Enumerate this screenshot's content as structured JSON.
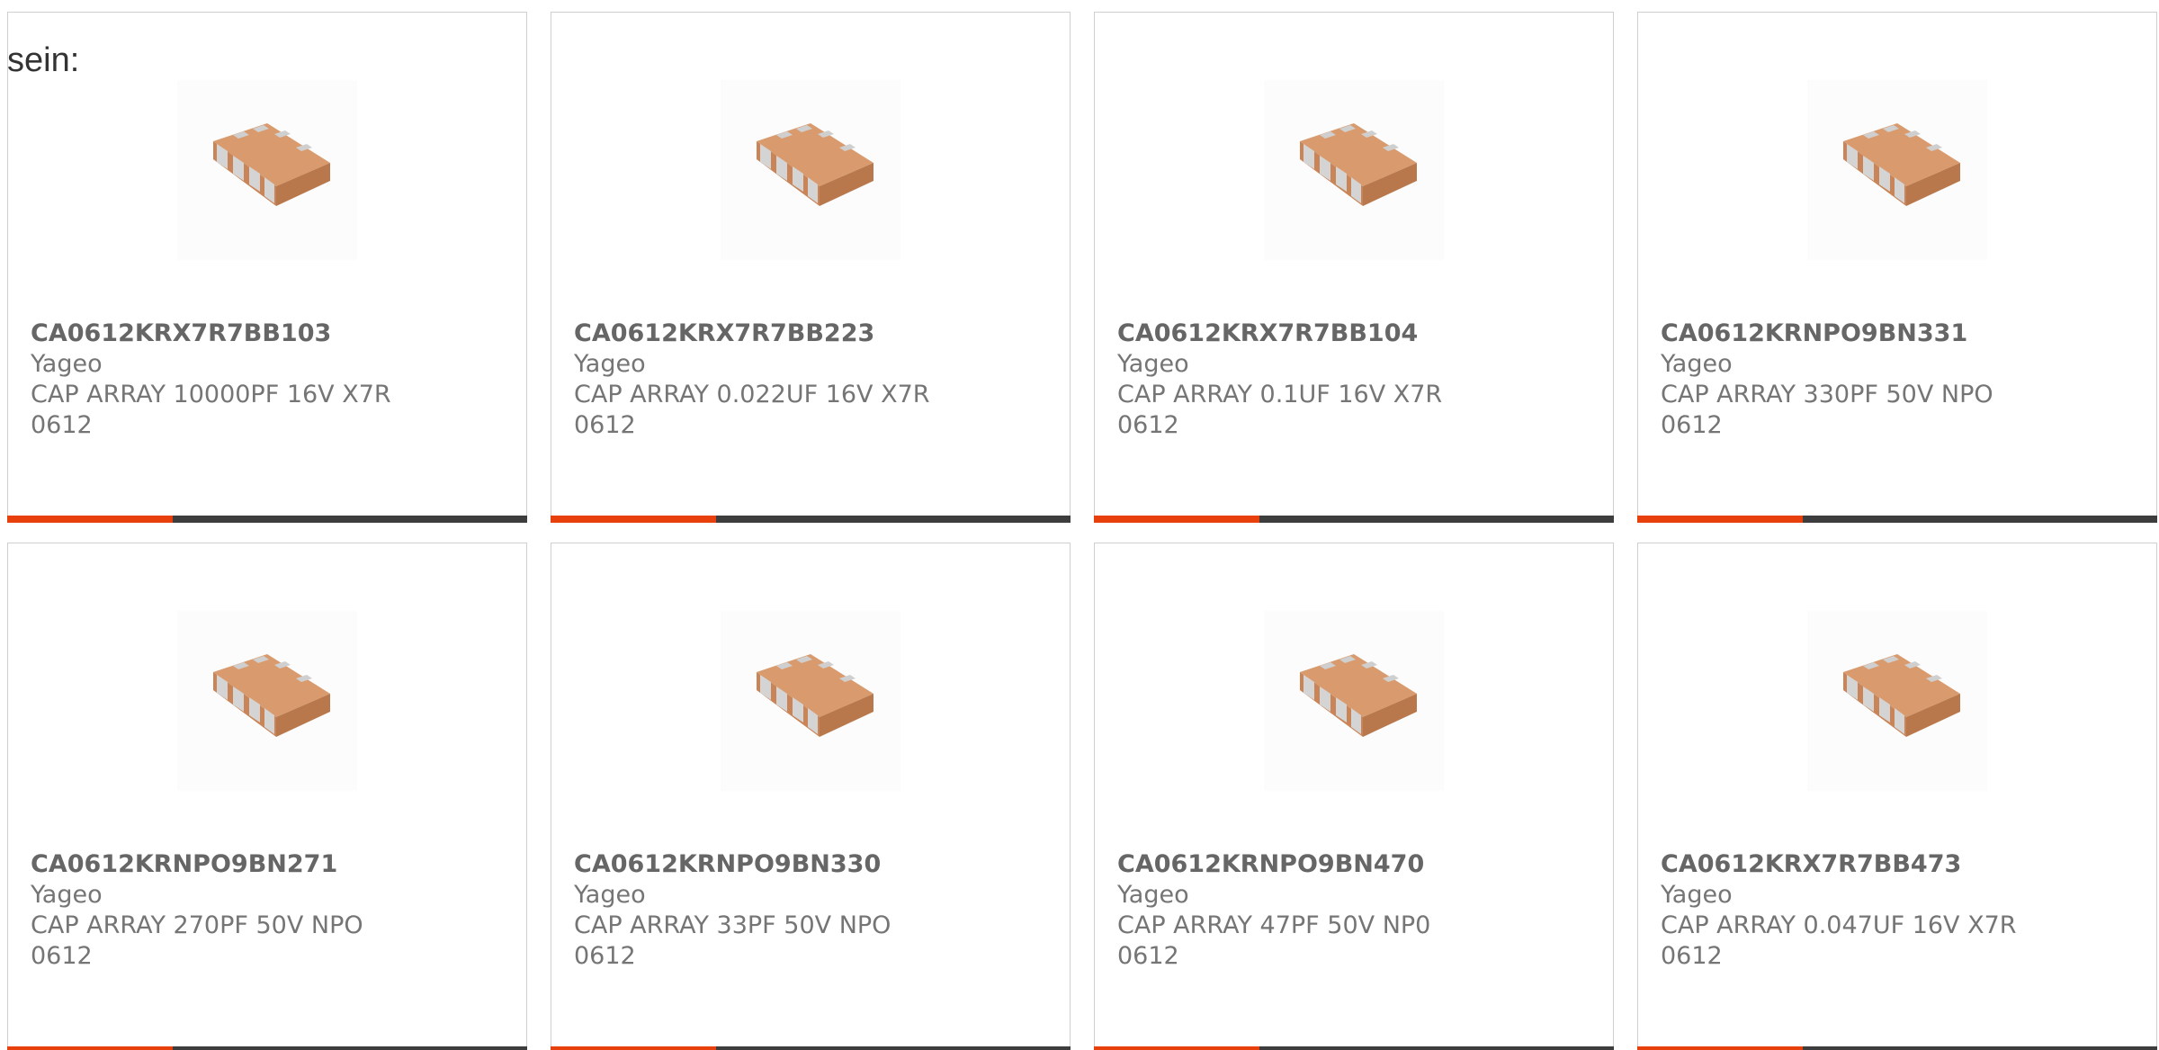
{
  "lead_text": "sein:",
  "colors": {
    "accent": "#e8400d",
    "bar_track": "#3d3d3d",
    "chip_body": "#d99b6e",
    "chip_terminal": "#c8c8c8"
  },
  "products": [
    {
      "part_number": "CA0612KRX7R7BB103",
      "manufacturer": "Yageo",
      "description": "CAP ARRAY 10000PF 16V X7R 0612",
      "image_icon": "capacitor-array-chip-icon"
    },
    {
      "part_number": "CA0612KRX7R7BB223",
      "manufacturer": "Yageo",
      "description": "CAP ARRAY 0.022UF 16V X7R 0612",
      "image_icon": "capacitor-array-chip-icon"
    },
    {
      "part_number": "CA0612KRX7R7BB104",
      "manufacturer": "Yageo",
      "description": "CAP ARRAY 0.1UF 16V X7R 0612",
      "image_icon": "capacitor-array-chip-icon"
    },
    {
      "part_number": "CA0612KRNPO9BN331",
      "manufacturer": "Yageo",
      "description": "CAP ARRAY 330PF 50V NPO 0612",
      "image_icon": "capacitor-array-chip-icon"
    },
    {
      "part_number": "CA0612KRNPO9BN271",
      "manufacturer": "Yageo",
      "description": "CAP ARRAY 270PF 50V NPO 0612",
      "image_icon": "capacitor-array-chip-icon"
    },
    {
      "part_number": "CA0612KRNPO9BN330",
      "manufacturer": "Yageo",
      "description": "CAP ARRAY 33PF 50V NPO 0612",
      "image_icon": "capacitor-array-chip-icon"
    },
    {
      "part_number": "CA0612KRNPO9BN470",
      "manufacturer": "Yageo",
      "description": "CAP ARRAY 47PF 50V NP0 0612",
      "image_icon": "capacitor-array-chip-icon"
    },
    {
      "part_number": "CA0612KRX7R7BB473",
      "manufacturer": "Yageo",
      "description": "CAP ARRAY 0.047UF 16V X7R 0612",
      "image_icon": "capacitor-array-chip-icon"
    }
  ]
}
